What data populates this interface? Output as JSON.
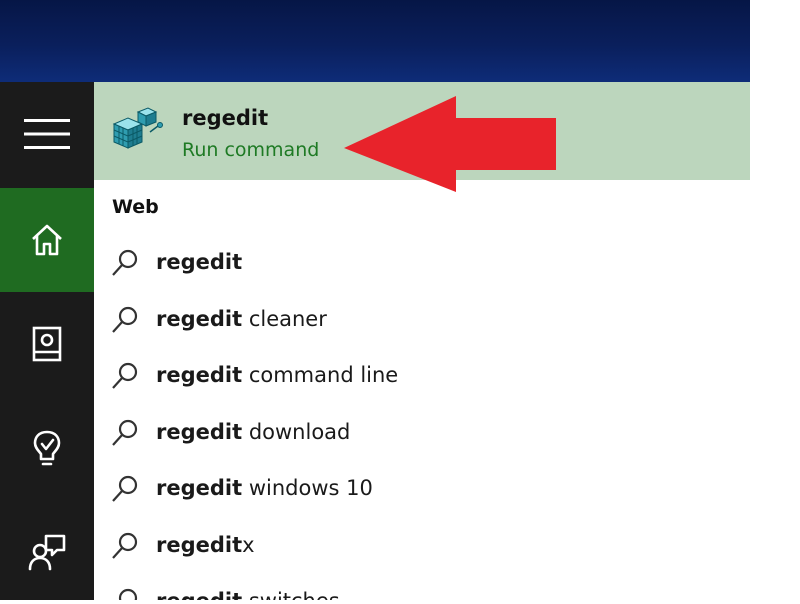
{
  "best_match": {
    "name": "regedit",
    "subtitle": "Run command"
  },
  "web_section": {
    "label": "Web",
    "results": [
      {
        "query": "regedit",
        "suffix": ""
      },
      {
        "query": "regedit",
        "suffix": " cleaner"
      },
      {
        "query": "regedit",
        "suffix": " command line"
      },
      {
        "query": "regedit",
        "suffix": " download"
      },
      {
        "query": "regedit",
        "suffix": " windows 10"
      },
      {
        "query": "regedit",
        "suffix": "x"
      },
      {
        "query": "regedit",
        "suffix": " switches"
      }
    ]
  },
  "sidebar": {
    "items": [
      {
        "icon": "hamburger-icon"
      },
      {
        "icon": "home-icon",
        "active": true
      },
      {
        "icon": "notebook-icon"
      },
      {
        "icon": "lightbulb-icon"
      },
      {
        "icon": "feedback-icon"
      }
    ]
  },
  "colors": {
    "sidebar_bg": "#1b1b1b",
    "active_green": "#1f6b21",
    "best_match_bg": "#bcd6bd",
    "subtitle_green": "#1e7a24",
    "arrow_red": "#e8232b"
  }
}
